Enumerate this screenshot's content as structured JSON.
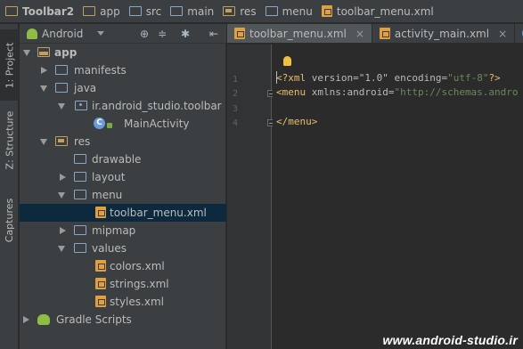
{
  "breadcrumbs": [
    {
      "label": "Toolbar2",
      "icon": "module-folder-icon"
    },
    {
      "label": "app",
      "icon": "module-folder-icon"
    },
    {
      "label": "src",
      "icon": "folder-icon"
    },
    {
      "label": "main",
      "icon": "folder-icon"
    },
    {
      "label": "res",
      "icon": "res-folder-icon"
    },
    {
      "label": "menu",
      "icon": "folder-icon"
    },
    {
      "label": "toolbar_menu.xml",
      "icon": "xml-file-icon"
    }
  ],
  "side_tabs": {
    "project": "1: Project",
    "structure": "Z: Structure",
    "captures": "Captures"
  },
  "project_panel": {
    "view_mode": "Android"
  },
  "tree": [
    {
      "label": "app",
      "icon": "app-module-icon",
      "expanded": true,
      "bold": true
    },
    {
      "label": "manifests",
      "icon": "folder-icon",
      "expanded": false
    },
    {
      "label": "java",
      "icon": "folder-icon",
      "expanded": true
    },
    {
      "label": "ir.android_studio.toolbar",
      "icon": "package-icon",
      "expanded": true
    },
    {
      "label": "MainActivity",
      "icon": "class-icon"
    },
    {
      "label": "res",
      "icon": "res-folder-icon",
      "expanded": true
    },
    {
      "label": "drawable",
      "icon": "folder-icon"
    },
    {
      "label": "layout",
      "icon": "folder-icon",
      "expanded": false
    },
    {
      "label": "menu",
      "icon": "folder-icon",
      "expanded": true
    },
    {
      "label": "toolbar_menu.xml",
      "icon": "xml-file-icon",
      "selected": true
    },
    {
      "label": "mipmap",
      "icon": "folder-icon",
      "expanded": false
    },
    {
      "label": "values",
      "icon": "folder-icon",
      "expanded": true
    },
    {
      "label": "colors.xml",
      "icon": "xml-file-icon"
    },
    {
      "label": "strings.xml",
      "icon": "xml-file-icon"
    },
    {
      "label": "styles.xml",
      "icon": "xml-file-icon"
    },
    {
      "label": "Gradle Scripts",
      "icon": "gradle-icon",
      "expanded": false
    }
  ],
  "editor_tabs": [
    {
      "label": "toolbar_menu.xml",
      "icon": "xml-file-icon",
      "active": true,
      "close": "×"
    },
    {
      "label": "activity_main.xml",
      "icon": "xml-file-icon",
      "active": false,
      "close": "×"
    },
    {
      "label": "Ma",
      "icon": "class-icon",
      "active": false
    }
  ],
  "line_numbers": [
    "1",
    "2",
    "3",
    "4"
  ],
  "code": {
    "line1": {
      "prolog_open": "<?xml ",
      "attrs": "version=\"1.0\" encoding=",
      "value": "\"utf-8\"",
      "prolog_close": "?>"
    },
    "line2": {
      "tag": "<menu ",
      "attrs": "xmlns:android=",
      "value": "\"http://schemas.andro"
    },
    "line3": {
      "text": ""
    },
    "line4": {
      "tag": "</menu>"
    }
  },
  "watermark": "www.android-studio.ir",
  "colors": {
    "selection": "#0d293e",
    "xml_tag": "#e8bf6a",
    "xml_string": "#6a8759",
    "panel_bg": "#3c3f41",
    "editor_bg": "#2b2b2b"
  }
}
